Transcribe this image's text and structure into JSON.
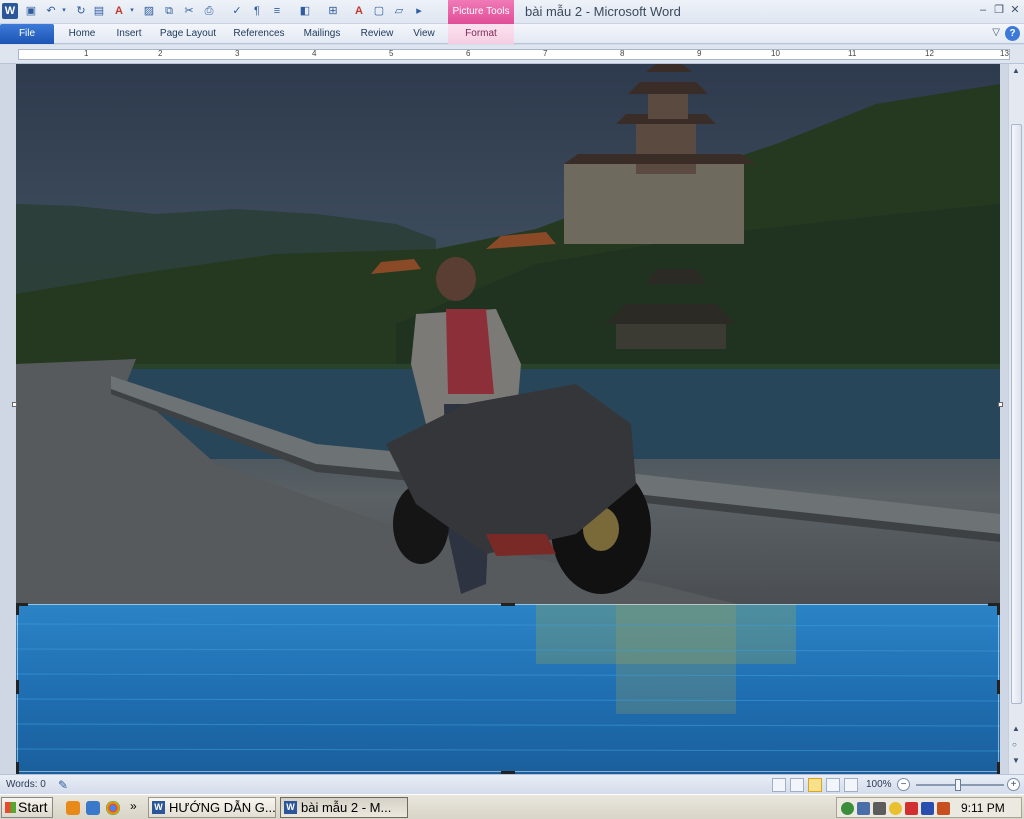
{
  "window": {
    "title": "bài mẫu 2  -  Microsoft Word",
    "contextual_group": "Picture Tools",
    "minimize": "–",
    "restore": "❐",
    "close": "✕"
  },
  "ribbon": {
    "tabs": [
      {
        "label": "File"
      },
      {
        "label": "Home"
      },
      {
        "label": "Insert"
      },
      {
        "label": "Page Layout"
      },
      {
        "label": "References"
      },
      {
        "label": "Mailings"
      },
      {
        "label": "Review"
      },
      {
        "label": "View"
      },
      {
        "label": "Format"
      }
    ],
    "help_label": "?",
    "collapse_label": "▽"
  },
  "ruler": {
    "numbers": [
      "1",
      "1",
      "2",
      "3",
      "4",
      "5",
      "6",
      "7",
      "8",
      "9",
      "10",
      "11",
      "12",
      "13"
    ]
  },
  "status": {
    "words": "Words: 0",
    "zoom": "100%",
    "zoom_level": 1.0
  },
  "taskbar": {
    "start_label": "Start",
    "overflow": "»",
    "buttons": [
      {
        "label": "HƯỚNG DẪN G..."
      },
      {
        "label": "bài mẫu 2 - M..."
      }
    ],
    "clock": "9:11 PM"
  },
  "colors": {
    "file_tab": "#1d55b5",
    "picture_tools": "#e14d97",
    "water": "#1f6fb2"
  }
}
